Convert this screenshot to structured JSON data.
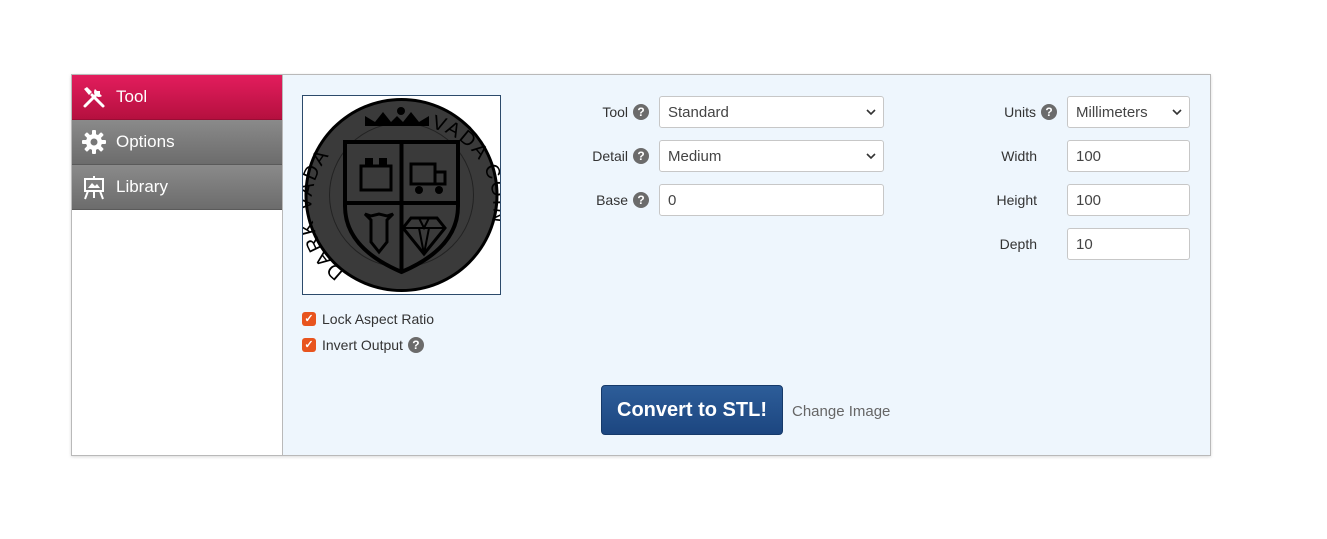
{
  "sidebar": {
    "items": [
      {
        "label": "Tool",
        "icon": "tools-icon",
        "active": true
      },
      {
        "label": "Options",
        "icon": "gear-icon",
        "active": false
      },
      {
        "label": "Library",
        "icon": "easel-icon",
        "active": false
      }
    ]
  },
  "preview": {
    "coin_text_left": "DARK VADA",
    "coin_text_right": "VADA COIN"
  },
  "checks": {
    "lock_aspect_label": "Lock Aspect Ratio",
    "invert_output_label": "Invert Output"
  },
  "form": {
    "tool_label": "Tool",
    "tool_value": "Standard",
    "detail_label": "Detail",
    "detail_value": "Medium",
    "base_label": "Base",
    "base_value": "0",
    "units_label": "Units",
    "units_value": "Millimeters",
    "width_label": "Width",
    "width_value": "100",
    "height_label": "Height",
    "height_value": "100",
    "depth_label": "Depth",
    "depth_value": "10"
  },
  "actions": {
    "convert_label": "Convert to STL!",
    "change_image_label": "Change Image"
  },
  "colors": {
    "active_nav": "#d31650",
    "inactive_nav": "#7a7a7a",
    "panel_bg": "#eef6fd",
    "checkbox": "#e8541e",
    "button": "#24508a"
  }
}
